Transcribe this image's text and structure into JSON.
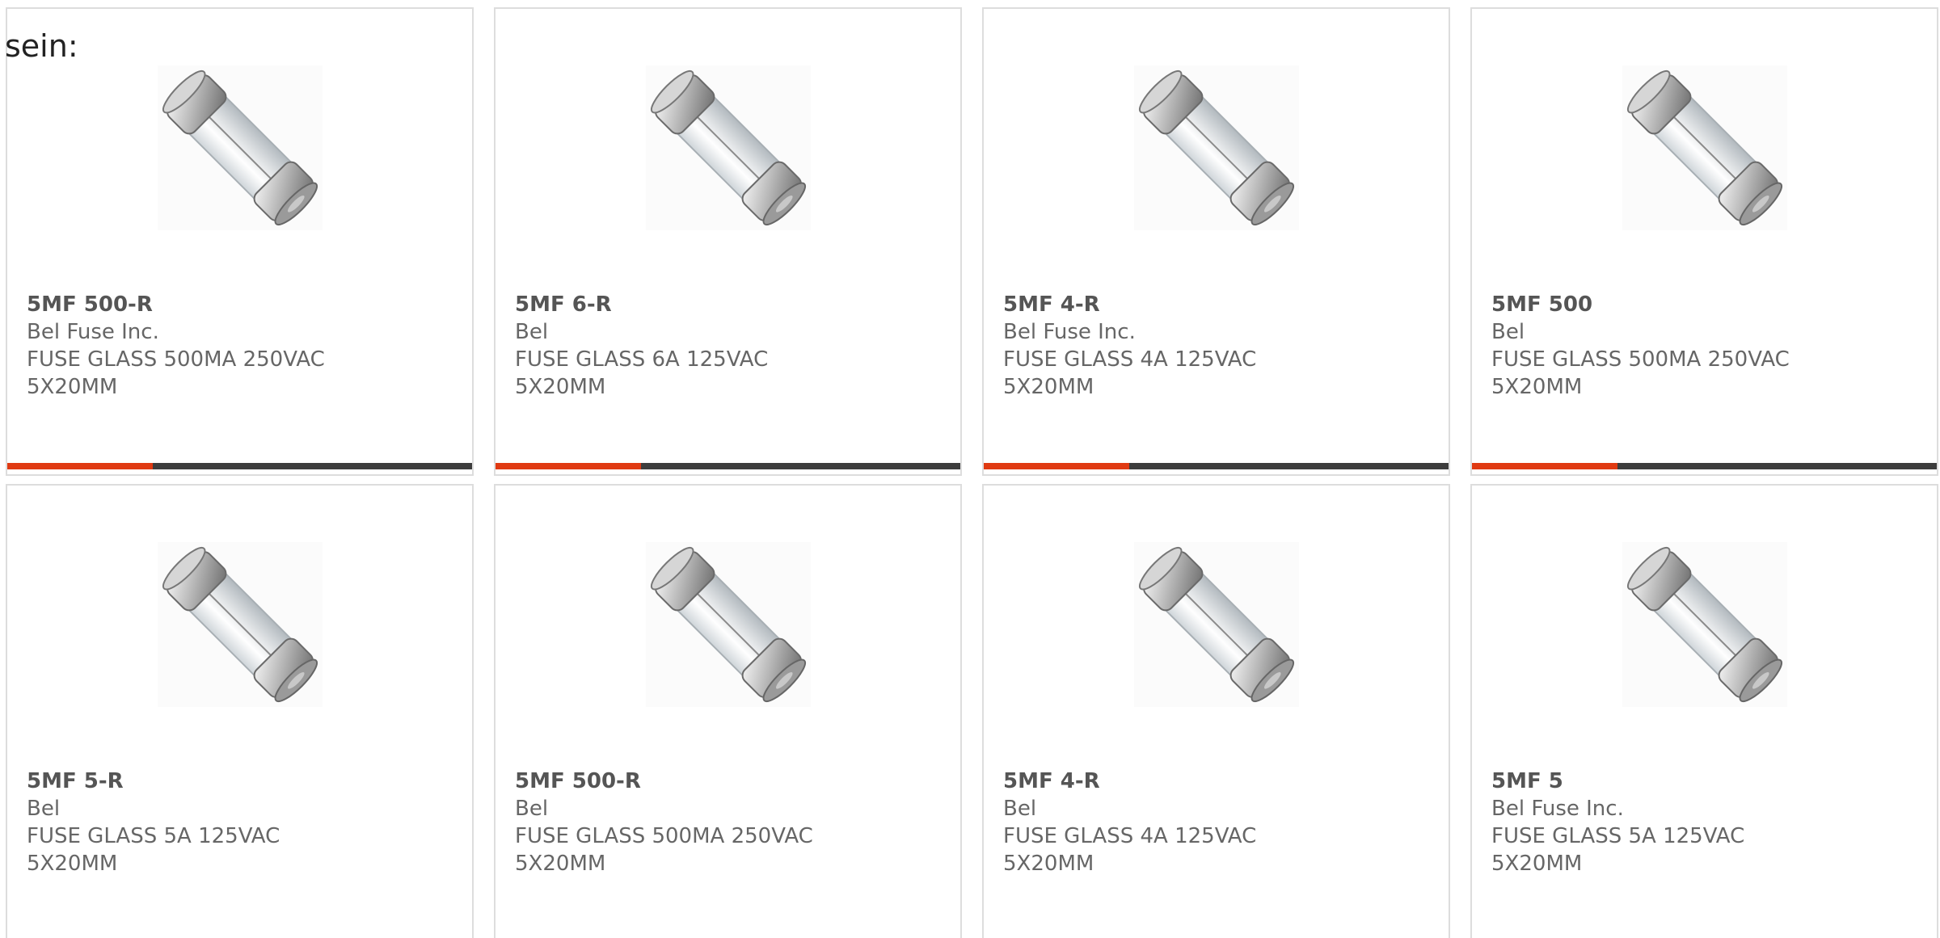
{
  "intro_text": "sein:",
  "colors": {
    "accent": "#e03a12",
    "bar_track": "#3d3d3d",
    "card_border": "#dddddd",
    "text": "#666666"
  },
  "products": [
    {
      "part": "5MF 500-R",
      "manufacturer": "Bel Fuse Inc.",
      "description": "FUSE GLASS 500MA 250VAC 5X20MM",
      "image_icon": "glass-fuse-icon"
    },
    {
      "part": "5MF 6-R",
      "manufacturer": "Bel",
      "description": "FUSE GLASS 6A 125VAC 5X20MM",
      "image_icon": "glass-fuse-icon"
    },
    {
      "part": "5MF 4-R",
      "manufacturer": "Bel Fuse Inc.",
      "description": "FUSE GLASS 4A 125VAC 5X20MM",
      "image_icon": "glass-fuse-icon"
    },
    {
      "part": "5MF 500",
      "manufacturer": "Bel",
      "description": "FUSE GLASS 500MA 250VAC 5X20MM",
      "image_icon": "glass-fuse-icon"
    },
    {
      "part": "5MF 5-R",
      "manufacturer": "Bel",
      "description": "FUSE GLASS 5A 125VAC 5X20MM",
      "image_icon": "glass-fuse-icon"
    },
    {
      "part": "5MF 500-R",
      "manufacturer": "Bel",
      "description": "FUSE GLASS 500MA 250VAC 5X20MM",
      "image_icon": "glass-fuse-icon"
    },
    {
      "part": "5MF 4-R",
      "manufacturer": "Bel",
      "description": "FUSE GLASS 4A 125VAC 5X20MM",
      "image_icon": "glass-fuse-icon"
    },
    {
      "part": "5MF 5",
      "manufacturer": "Bel Fuse Inc.",
      "description": "FUSE GLASS 5A 125VAC 5X20MM",
      "image_icon": "glass-fuse-icon"
    }
  ]
}
